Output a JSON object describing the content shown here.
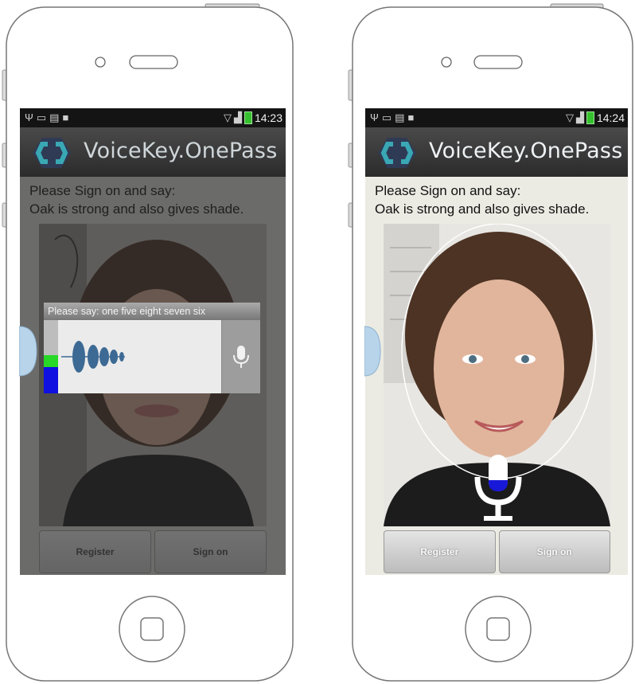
{
  "status_bar_left": {
    "time": "14:23"
  },
  "status_bar_right": {
    "time": "14:24"
  },
  "app": {
    "title": "VoiceKey.OnePass"
  },
  "prompt": {
    "line1": "Please Sign on and say:",
    "line2": "Oak is strong and also gives shade."
  },
  "voice_dialog": {
    "title": "Please say: one five eight seven six",
    "level_colors": [
      "#27d827",
      "#1010e0"
    ]
  },
  "buttons": {
    "register": "Register",
    "sign_on": "Sign on"
  },
  "colors": {
    "logo": "#3aa8b4",
    "mic_fill": "#1818d8",
    "waveform": "#3d6a94"
  },
  "icons": {
    "mic": "microphone-icon",
    "logo": "voicekey-logo"
  }
}
